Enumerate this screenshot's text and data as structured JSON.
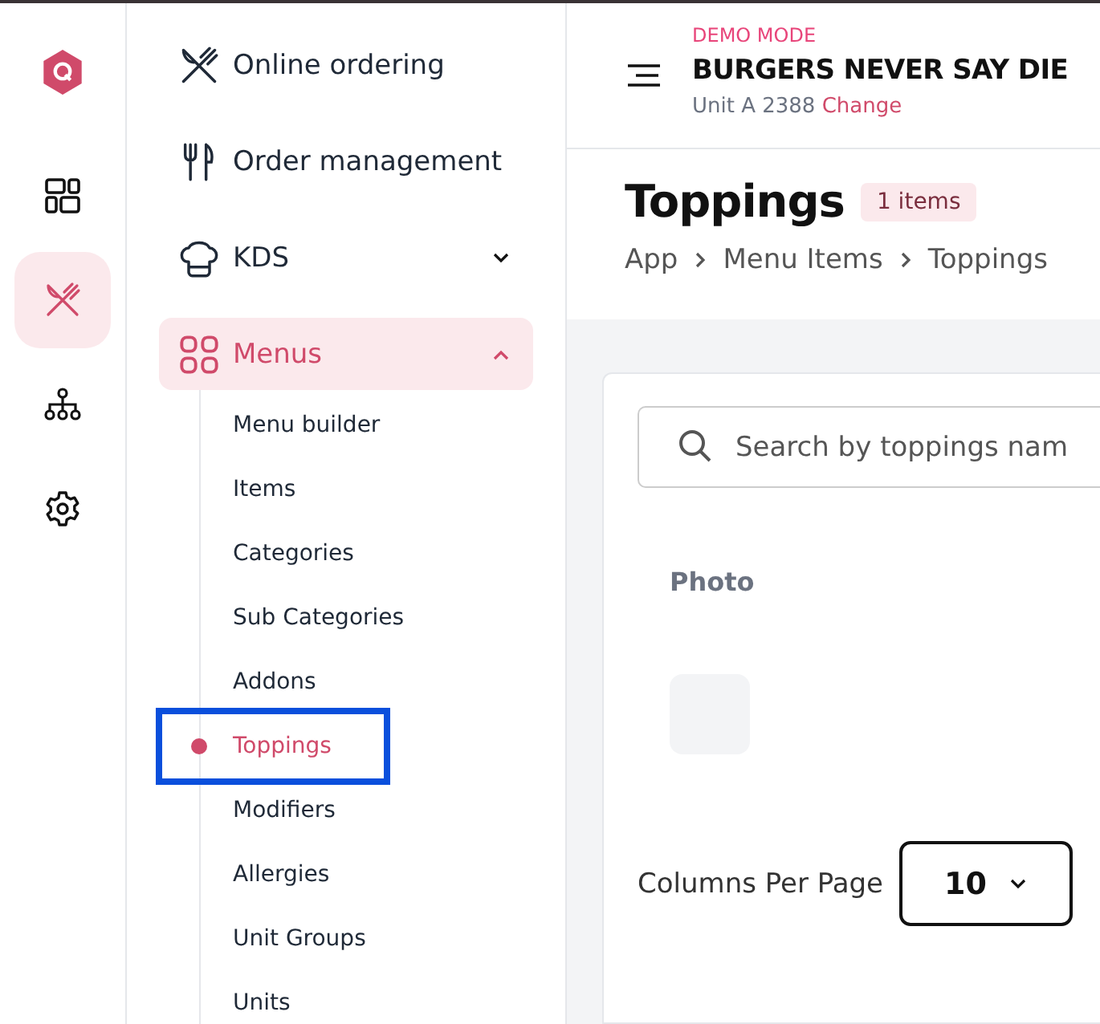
{
  "rail_items": [
    {
      "kind": "grid",
      "selected": false
    },
    {
      "kind": "dining",
      "selected": true
    },
    {
      "kind": "network",
      "selected": false
    },
    {
      "kind": "settings",
      "selected": false
    }
  ],
  "sidebar": {
    "items": [
      {
        "kind": "dining",
        "label": "Online ordering",
        "selected": false
      },
      {
        "kind": "utensils",
        "label": "Order management",
        "selected": false
      },
      {
        "kind": "chef",
        "label": "KDS",
        "selected": false,
        "expanded": false
      },
      {
        "kind": "menus",
        "label": "Menus",
        "selected": true,
        "expanded": true,
        "children": [
          {
            "label": "Menu builder",
            "selected": false,
            "outlined": false
          },
          {
            "label": "Items",
            "selected": false,
            "outlined": false
          },
          {
            "label": "Categories",
            "selected": false,
            "outlined": false
          },
          {
            "label": "Sub Categories",
            "selected": false,
            "outlined": false
          },
          {
            "label": "Addons",
            "selected": false,
            "outlined": false
          },
          {
            "label": "Toppings",
            "selected": true,
            "outlined": true
          },
          {
            "label": "Modifiers",
            "selected": false,
            "outlined": false
          },
          {
            "label": "Allergies",
            "selected": false,
            "outlined": false
          },
          {
            "label": "Unit Groups",
            "selected": false,
            "outlined": false
          },
          {
            "label": "Units",
            "selected": false,
            "outlined": false
          }
        ]
      }
    ]
  },
  "header": {
    "mode": "DEMO MODE",
    "business": "BURGERS NEVER SAY DIE",
    "unit": "Unit A 2388",
    "change_link": "Change"
  },
  "page": {
    "title": "Toppings",
    "count_badge": "1 items",
    "breadcrumb": [
      "App",
      "Menu Items",
      "Toppings"
    ]
  },
  "search": {
    "placeholder": "Search by toppings nam"
  },
  "table": {
    "columns": [
      "Photo"
    ],
    "rows": [
      {
        "photo": true
      }
    ]
  },
  "pagination": {
    "label": "Columns Per Page",
    "per_page": "10"
  }
}
